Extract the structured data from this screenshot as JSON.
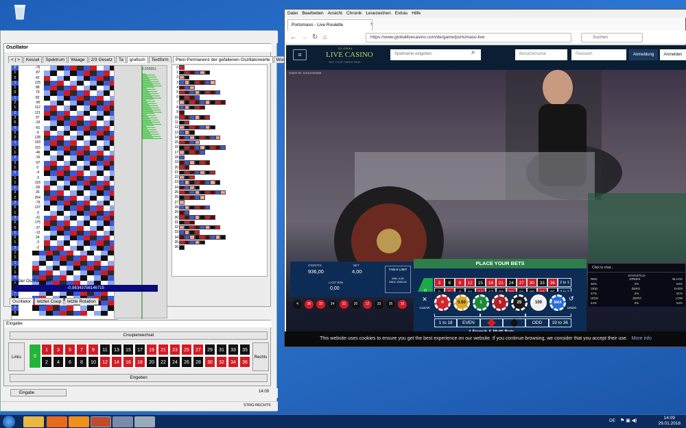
{
  "left_app": {
    "osc_title": "Oszillator",
    "tabs": [
      "< | >",
      "Kessel",
      "Spektrum",
      "Waage",
      "2/3 Gesetz",
      "Ta",
      "grafisch",
      "Textform"
    ],
    "perm_tab": "Plein-Permanenz der gefallenen Oszillatorwerte",
    "perm_tab2": "Wurfwe",
    "graf_value": "5.555551",
    "osc_label": "letzter Oszillatorwert",
    "osc_value": "-0.86343756146715",
    "bottom_tabs": [
      "Oszillator",
      "letzter Coup",
      "letzte Rotation"
    ],
    "eingabe_title": "Eingabe",
    "croupier": "Croupierwechsel",
    "links": "Links",
    "rechts": "Rechts",
    "zero": "0",
    "eingeben": "Eingeben",
    "status_left": "Eingabe",
    "status_time": "14:09",
    "tray_text": "STRG-RECHTS",
    "row_numbers": [
      "0",
      "1",
      "0",
      "1",
      "1",
      "0",
      "1",
      "2",
      "1",
      "2",
      "3",
      "0",
      "0",
      "0",
      "2",
      "1",
      "1",
      "1",
      "2",
      "3",
      "1",
      "0",
      "1",
      "1",
      "1",
      "3",
      "2",
      "2",
      "0",
      "1",
      "3",
      "0",
      "0",
      "1",
      "0",
      "1",
      "3",
      "1",
      "1",
      "1",
      "2",
      "1",
      "0",
      "2",
      "1",
      "0",
      "1",
      "3",
      "1",
      "0",
      "1"
    ],
    "row_values": [
      "-76",
      "-87",
      "42",
      "125",
      "88",
      "79",
      "82",
      "-90",
      "112",
      "121",
      "97",
      "-33",
      "-81",
      "-6",
      "128",
      "193",
      "115",
      "-46",
      "-16",
      "-97",
      "0",
      "-4",
      "-3",
      "118",
      "-56",
      "26",
      "254",
      "-79",
      "137",
      "-3",
      "-31",
      "175",
      "-37",
      "-12",
      "24",
      "-3",
      "-2"
    ],
    "perm_numbers": [
      "0",
      "1",
      "2",
      "3",
      "4",
      "5",
      "6",
      "7",
      "8",
      "9",
      "10",
      "11",
      "12",
      "13",
      "14",
      "15",
      "16",
      "17",
      "18",
      "19",
      "20",
      "21",
      "22",
      "23",
      "24",
      "25",
      "26",
      "27",
      "28",
      "29",
      "30",
      "31",
      "32",
      "33",
      "34",
      "35",
      "36"
    ]
  },
  "browser": {
    "menu": [
      "Datei",
      "Bearbeiten",
      "Ansicht",
      "Chronik",
      "Lesezeichen",
      "Extras",
      "Hilfe"
    ],
    "tab_title": "Portomaso - Live Roulette",
    "url": "https://www.globallivecasino.com/de/game/portomaso-live",
    "search": "Suchen",
    "brand_small": "GLOBAL",
    "brand": "LIVE CASINO",
    "brand_sub": "SEE YOUR CARDS DEAL",
    "game_search": "Spielname eingeben",
    "user": "Benutzername",
    "pass": "Passwort",
    "login": "Anmeldung",
    "register": "Anmelden",
    "game_id": "Game ID: 11511231556",
    "place_bets": "PLACE YOUR BETS",
    "credits_label": "CREDITS",
    "credits": "936,00",
    "bet_label": "BET",
    "bet": "4,00",
    "table_limit": "TABLE LIMIT",
    "min": "MIN: 0,00",
    "max": "MAX: 2000,00",
    "lastwin_label": "LAST WIN",
    "lastwin": "0,00",
    "french": "^ French & Multi Bets",
    "dozens": [
      "1st 12",
      "2nd 12",
      "3rd 12"
    ],
    "outside": [
      "1 to 18",
      "EVEN",
      "",
      "",
      "ODD",
      "19 to 36"
    ],
    "col2to1": "2 to 1",
    "history": [
      "4",
      "36",
      "19",
      "24",
      "21",
      "20",
      "12",
      "33",
      "35",
      "16"
    ],
    "chips": [
      "0.50",
      "1",
      "5",
      "25",
      "100",
      "MAX"
    ],
    "clear": "CLEAR",
    "undo": "UNDO",
    "chat": "Click to chat...",
    "stats": "STATISTICS",
    "stat_rows": [
      [
        "RED",
        "GREEN",
        "BLACK"
      ],
      [
        "45%",
        "2%",
        "53%"
      ],
      [
        "ODD",
        "ZERO",
        "EVEN"
      ],
      [
        "47%",
        "2%",
        "51%"
      ],
      [
        "HIGH",
        "ZERO",
        "LOW"
      ],
      [
        "44%",
        "2%",
        "54%"
      ]
    ],
    "cookie": "This website uses cookies to ensure you get the best experience on our website. If you continue browsing, we consider that you accept their use.",
    "cookie_link": "More info"
  },
  "taskbar": {
    "lang": "DE",
    "time": "14:09",
    "date": "29.01.2018"
  }
}
